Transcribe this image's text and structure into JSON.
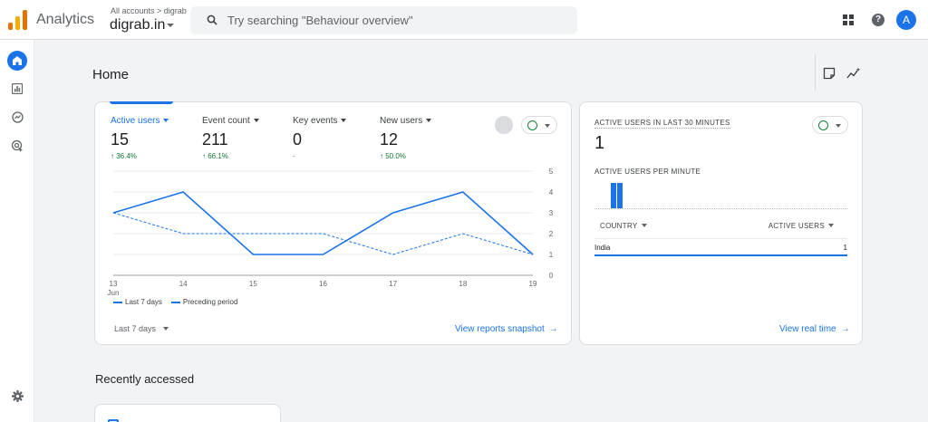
{
  "app": {
    "title": "Analytics"
  },
  "account": {
    "breadcrumb": "All accounts > digrab",
    "property": "digrab.in"
  },
  "search": {
    "placeholder": "Try searching \"Behaviour overview\""
  },
  "user": {
    "avatar_letter": "A"
  },
  "page": {
    "title": "Home"
  },
  "colors": {
    "accent": "#1a73e8",
    "positive": "#137333",
    "check": "#188038"
  },
  "icons": {
    "rail": [
      "home-icon",
      "reports-icon",
      "explore-icon",
      "advertising-icon",
      "settings-icon"
    ],
    "header": [
      "notes-icon",
      "insights-icon"
    ]
  },
  "metrics": [
    {
      "label": "Active users",
      "value": "15",
      "change": "↑ 36.4%"
    },
    {
      "label": "Event count",
      "value": "211",
      "change": "↑ 66.1%"
    },
    {
      "label": "Key events",
      "value": "0",
      "change": "-"
    },
    {
      "label": "New users",
      "value": "12",
      "change": "↑ 50.0%"
    }
  ],
  "chart_data": {
    "type": "line",
    "x": [
      "13 Jun",
      "14",
      "15",
      "16",
      "17",
      "18",
      "19"
    ],
    "series": [
      {
        "name": "Last 7 days",
        "style": "solid",
        "values": [
          3,
          4,
          1,
          1,
          3,
          4,
          1
        ]
      },
      {
        "name": "Preceding period",
        "style": "dashed",
        "values": [
          3,
          2,
          2,
          2,
          1,
          2,
          1
        ]
      }
    ],
    "yticks": [
      0,
      1,
      2,
      3,
      4,
      5
    ],
    "ylim": [
      0,
      5
    ],
    "y_axis_side": "right",
    "grid": true,
    "legend_position": "bottom-left"
  },
  "main_card": {
    "date_range": "Last 7 days",
    "link": "View reports snapshot"
  },
  "realtime": {
    "title": "ACTIVE USERS IN LAST 30 MINUTES",
    "value": "1",
    "per_minute_label": "ACTIVE USERS PER MINUTE",
    "per_minute": [
      1,
      1
    ],
    "col_country": "COUNTRY",
    "col_users": "ACTIVE USERS",
    "rows": [
      {
        "country": "India",
        "users": "1"
      }
    ],
    "link": "View real time"
  },
  "recent": {
    "title": "Recently accessed"
  }
}
